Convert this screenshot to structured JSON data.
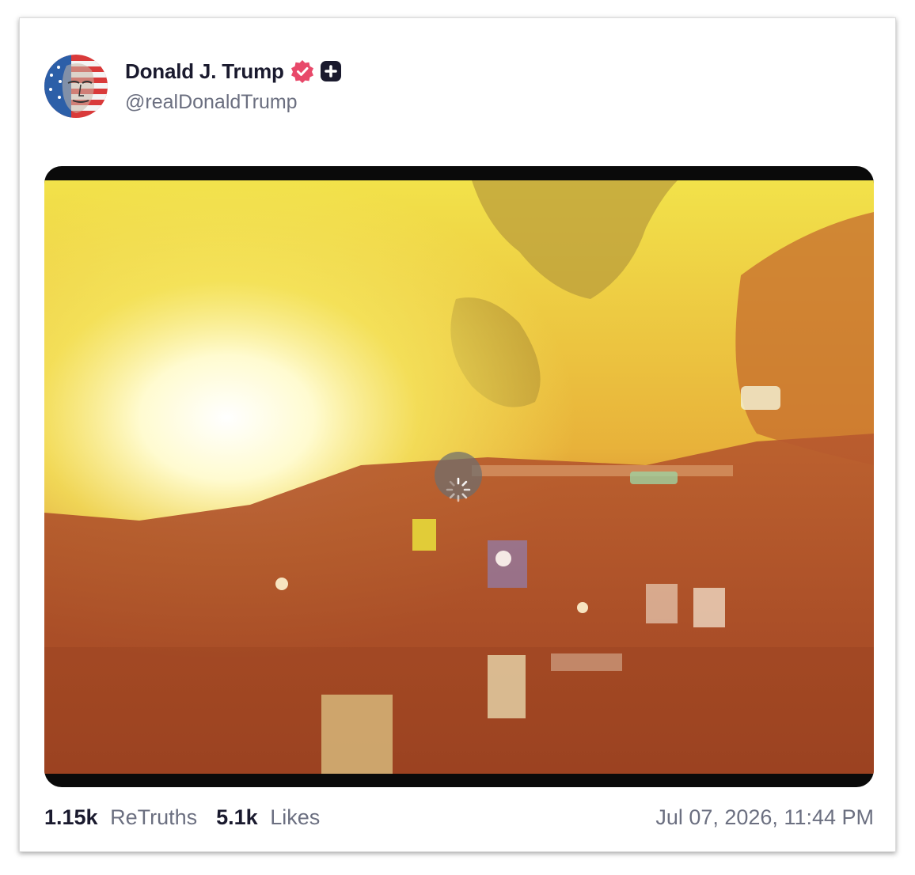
{
  "post": {
    "author": {
      "name": "Donald J. Trump",
      "handle": "@realDonaldTrump",
      "avatar_icon": "flag-portrait-avatar",
      "verified_icon": "verified-badge-icon",
      "plus_icon": "plus-badge-icon"
    },
    "media": {
      "type": "video",
      "state": "loading",
      "spinner_icon": "loading-spinner-icon"
    },
    "stats": {
      "retruths_count": "1.15k",
      "retruths_label": "ReTruths",
      "likes_count": "5.1k",
      "likes_label": "Likes"
    },
    "timestamp": "Jul 07, 2026, 11:44 PM"
  },
  "colors": {
    "verified": "#e8496a",
    "text_primary": "#1a1a2e",
    "text_secondary": "#6b6f80"
  }
}
